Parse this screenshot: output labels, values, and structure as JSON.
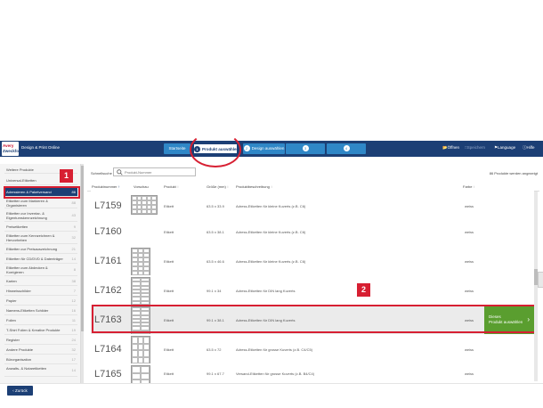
{
  "header": {
    "logo_line1": "Avery",
    "logo_line2": "Zweckform",
    "app_title": "Design & Print Online",
    "steps": [
      {
        "label": "Startseite",
        "num": ""
      },
      {
        "label": "Produkt auswählen",
        "num": "1"
      },
      {
        "label": "Design auswählen",
        "num": "2"
      },
      {
        "label": "",
        "num": "3"
      },
      {
        "label": "",
        "num": "4"
      }
    ],
    "links": {
      "open": "Öffnen",
      "save": "Speichern",
      "language": "Language",
      "help": "Hilfe"
    }
  },
  "sidebar": {
    "items": [
      {
        "label": "Weitere Produkte",
        "count": ""
      },
      {
        "label": "Universal-Etiketten",
        "count": ""
      },
      {
        "label": "Adressieren & Paketversand",
        "count": "86"
      },
      {
        "label": "Etiketten zum Markieren & Organisieren",
        "count": "88"
      },
      {
        "label": "Etiketten zur Inventar- & Eigentumskennzeichnung",
        "count": "43"
      },
      {
        "label": "Preisetiketten",
        "count": "9"
      },
      {
        "label": "Etiketten zum Kennzeichnen & Hervorheben",
        "count": "32"
      },
      {
        "label": "Etiketten zur Preisauszeichnung",
        "count": "21"
      },
      {
        "label": "Etiketten für CD/DVD & Datenträger",
        "count": "14"
      },
      {
        "label": "Etiketten zum Abdecken & Korrigieren",
        "count": "8"
      },
      {
        "label": "Karten",
        "count": "38"
      },
      {
        "label": "Hinweisschilder",
        "count": "7"
      },
      {
        "label": "Papier",
        "count": "12"
      },
      {
        "label": "Namens-Etiketten Schilder",
        "count": "16"
      },
      {
        "label": "Folien",
        "count": "11"
      },
      {
        "label": "T-Shirt Folien & Kreative Produkte",
        "count": "19"
      },
      {
        "label": "Register",
        "count": "24"
      },
      {
        "label": "Andere Produkte",
        "count": "32"
      },
      {
        "label": "Bürorganisation",
        "count": "17"
      },
      {
        "label": "Anwalts- & Notaretiketten",
        "count": "14"
      }
    ],
    "step_badge": "1"
  },
  "search": {
    "label": "Schnellsuche",
    "placeholder": "Produkt-Nummer"
  },
  "results_count": "86 Produkte werden angezeigt",
  "table": {
    "headers": {
      "product_number": "Produktnummer",
      "preview": "Vorschau",
      "product": "Produkt",
      "size": "Größe (mm)",
      "description": "Produktbeschreibung",
      "color": "Farbe"
    },
    "rows": [
      {
        "code": "L7159",
        "product": "Etikett",
        "size": "63.5 x 33.9",
        "description": "Adress-Etiketten für kleine Kuverts (z.B. C6)",
        "color": "weiss"
      },
      {
        "code": "L7160",
        "product": "Etikett",
        "size": "63.5 x 38.1",
        "description": "Adress-Etiketten für kleine Kuverts (z.B. C6)",
        "color": "weiss"
      },
      {
        "code": "L7161",
        "product": "Etikett",
        "size": "63.5 x 46.6",
        "description": "Adress-Etiketten für kleine Kuverts (z.B. C6)",
        "color": "weiss"
      },
      {
        "code": "L7162",
        "product": "Etikett",
        "size": "99.1 x 34",
        "description": "Adress-Etiketten für DIN lang Kuverts",
        "color": "weiss"
      },
      {
        "code": "L7163",
        "product": "Etikett",
        "size": "99.1 x 38.1",
        "description": "Adress-Etiketten für DIN lang Kuverts",
        "color": "weiss"
      },
      {
        "code": "L7164",
        "product": "Etikett",
        "size": "63.5 x 72",
        "description": "Adress-Etiketten für grosse Kuverts (z.B. C4/C5)",
        "color": "weiss"
      },
      {
        "code": "L7165",
        "product": "Etikett",
        "size": "99.1 x 67.7",
        "description": "Versand-Etiketten für grosse Kuverts (z.B. B4/C4)",
        "color": "weiss"
      }
    ],
    "selected_row_button": {
      "line1": "Dieses",
      "line2": "Produkt auswählen"
    },
    "step_badge": "2"
  },
  "footer": {
    "back_label": "Zurück"
  }
}
